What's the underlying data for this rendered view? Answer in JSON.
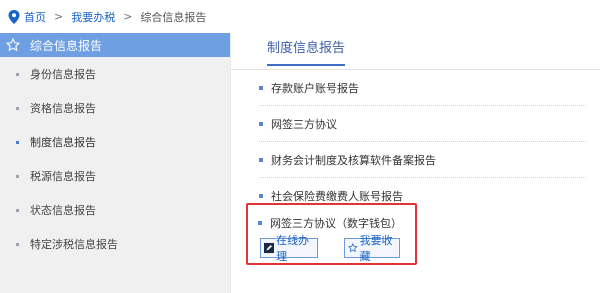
{
  "breadcrumb": {
    "home": "首页",
    "sep1": ">",
    "section": "我要办税",
    "sep2": ">",
    "current": "综合信息报告"
  },
  "sidebar": {
    "title": "综合信息报告",
    "items": [
      {
        "label": "身份信息报告"
      },
      {
        "label": "资格信息报告"
      },
      {
        "label": "制度信息报告",
        "active": true
      },
      {
        "label": "税源信息报告"
      },
      {
        "label": "状态信息报告"
      },
      {
        "label": "特定涉税信息报告"
      }
    ]
  },
  "main": {
    "tab_title": "制度信息报告",
    "reports": [
      {
        "label": "存款账户账号报告"
      },
      {
        "label": "网签三方协议"
      },
      {
        "label": "财务会计制度及核算软件备案报告"
      },
      {
        "label": "社会保险费缴费人账号报告"
      }
    ],
    "highlighted": {
      "label": "网签三方协议（数字钱包）",
      "online_button": "在线办理",
      "favorite_button": "我要收藏"
    }
  },
  "colors": {
    "accent": "#6f9fe3",
    "link": "#1a64c8",
    "highlight_border": "#e23434"
  }
}
